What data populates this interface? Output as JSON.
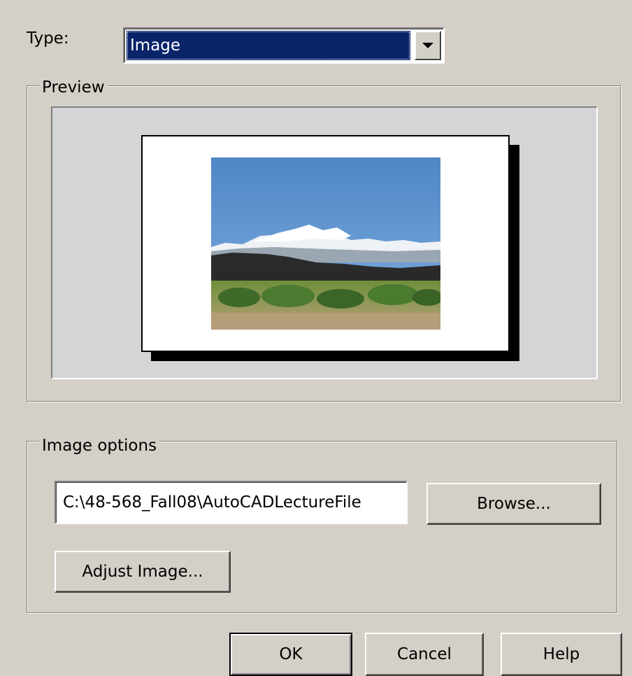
{
  "type_row": {
    "label": "Type:",
    "selected": "Image"
  },
  "preview": {
    "title": "Preview"
  },
  "image_options": {
    "title": "Image options",
    "path_value": "C:\\48-568_Fall08\\AutoCADLectureFile",
    "browse_label": "Browse...",
    "adjust_label": "Adjust Image..."
  },
  "buttons": {
    "ok": "OK",
    "cancel": "Cancel",
    "help": "Help"
  },
  "icons": {
    "dropdown": "chevron-down-icon"
  }
}
